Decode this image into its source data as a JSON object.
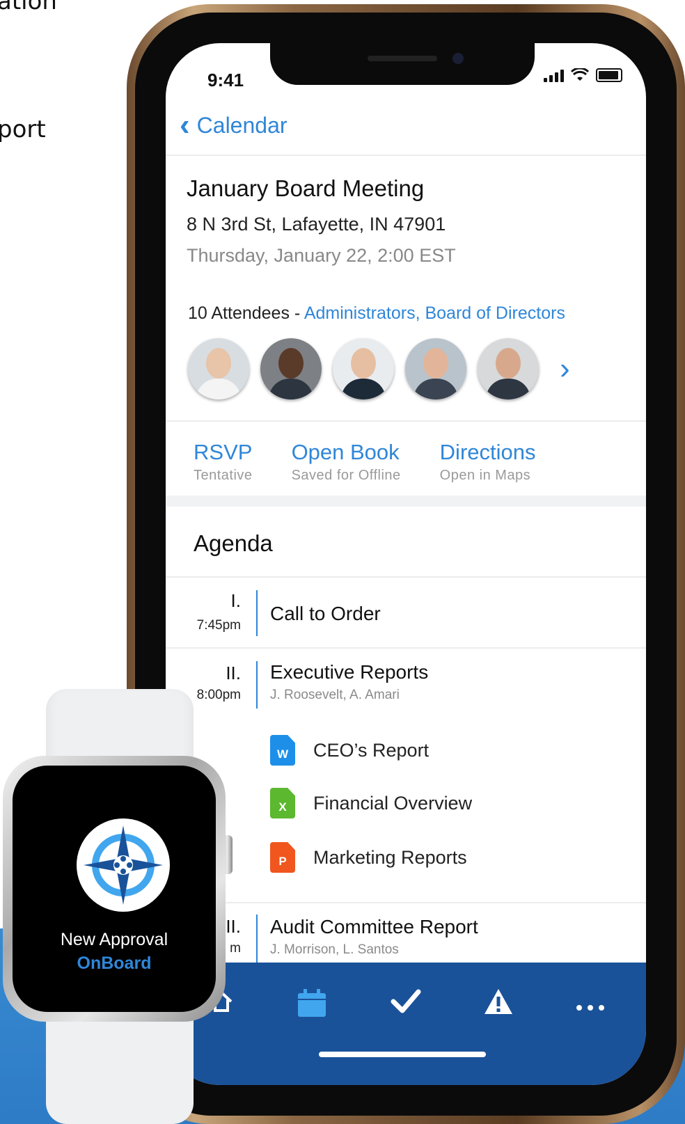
{
  "side_text": {
    "line1": "ation",
    "line2": "port"
  },
  "status": {
    "time": "9:41"
  },
  "nav": {
    "back_label": "Calendar"
  },
  "meeting": {
    "title": "January Board Meeting",
    "address": "8 N 3rd St, Lafayette, IN 47901",
    "datetime": "Thursday, January 22, 2:00 EST",
    "attendees_count": "10 Attendees",
    "attendees_separator": " - ",
    "attendees_groups": "Administrators, Board of Directors"
  },
  "actions": [
    {
      "label": "RSVP",
      "sub": "Tentative"
    },
    {
      "label": "Open Book",
      "sub": "Saved for Offline"
    },
    {
      "label": "Directions",
      "sub": "Open in Maps"
    }
  ],
  "agenda": {
    "title": "Agenda",
    "items": [
      {
        "num": "I.",
        "time": "7:45pm",
        "title": "Call to Order",
        "presenters": ""
      },
      {
        "num": "II.",
        "time": "8:00pm",
        "title": "Executive Reports",
        "presenters": "J. Roosevelt, A. Amari"
      },
      {
        "num": "II.",
        "time": "m",
        "title": "Audit Committee Report",
        "presenters": "J. Morrison, L. Santos"
      }
    ],
    "documents": [
      {
        "icon": "W",
        "label": "CEO’s Report",
        "color": "#1e8fe8"
      },
      {
        "icon": "X",
        "label": "Financial Overview",
        "color": "#5cb82e"
      },
      {
        "icon": "P",
        "label": "Marketing Reports",
        "color": "#f0561e"
      }
    ]
  },
  "watch": {
    "line1": "New Approval",
    "line2": "OnBoard"
  },
  "colors": {
    "accent": "#2f86d8",
    "tabbar": "#1a5299",
    "background_wave": "#3a8fd4"
  }
}
